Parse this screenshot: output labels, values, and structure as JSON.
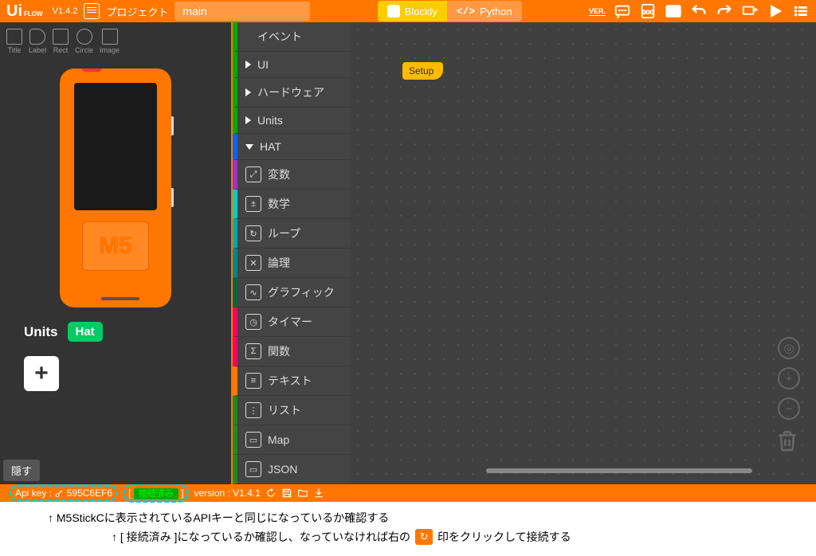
{
  "header": {
    "logo_main": "Ui",
    "logo_sub": "FLOW",
    "version": "V1.4.2",
    "project_label": "プロジェクト",
    "project_name": "main",
    "ver_badge": "VER.",
    "tabs": {
      "blockly": "Blockly",
      "python": "Python"
    }
  },
  "tools": [
    {
      "name": "Title"
    },
    {
      "name": "Label"
    },
    {
      "name": "Rect"
    },
    {
      "name": "Circle"
    },
    {
      "name": "Image"
    }
  ],
  "device": {
    "button_text": "M5"
  },
  "units": {
    "label": "Units",
    "hat": "Hat",
    "add": "+"
  },
  "hide_btn": "隠す",
  "categories": [
    {
      "label": "イベント",
      "color": "green",
      "expand": "none"
    },
    {
      "label": "UI",
      "color": "green",
      "expand": "right"
    },
    {
      "label": "ハードウェア",
      "color": "green",
      "expand": "right"
    },
    {
      "label": "Units",
      "color": "green",
      "expand": "right"
    },
    {
      "label": "HAT",
      "color": "blue",
      "expand": "down"
    },
    {
      "label": "変数",
      "color": "purple",
      "icon": "⤢"
    },
    {
      "label": "数学",
      "color": "cyan",
      "icon": "±"
    },
    {
      "label": "ループ",
      "color": "teal",
      "icon": "↻"
    },
    {
      "label": "論理",
      "color": "dcyan",
      "icon": "✕"
    },
    {
      "label": "グラフィック",
      "color": "dgreen",
      "icon": "∿"
    },
    {
      "label": "タイマー",
      "color": "pink",
      "icon": "◷"
    },
    {
      "label": "関数",
      "color": "pink",
      "icon": "Σ"
    },
    {
      "label": "テキスト",
      "color": "orange",
      "icon": "≡"
    },
    {
      "label": "リスト",
      "color": "dgreen2",
      "icon": "⋮"
    },
    {
      "label": "Map",
      "color": "dgreen2",
      "icon": "▭"
    },
    {
      "label": "JSON",
      "color": "dgreen2",
      "icon": "▭"
    }
  ],
  "canvas": {
    "setup": "Setup"
  },
  "footer": {
    "api_label": "Api key :",
    "api_key": "595C6EF6",
    "status": "接続済み",
    "version_label": "version : V1.4.1"
  },
  "annotations": {
    "line1": "↑  M5StickCに表示されているAPIキーと同じになっているか確認する",
    "line2a": "↑  [ 接続済み ]になっているか確認し、なっていなければ右の",
    "line2b": "印をクリックして接続する"
  }
}
